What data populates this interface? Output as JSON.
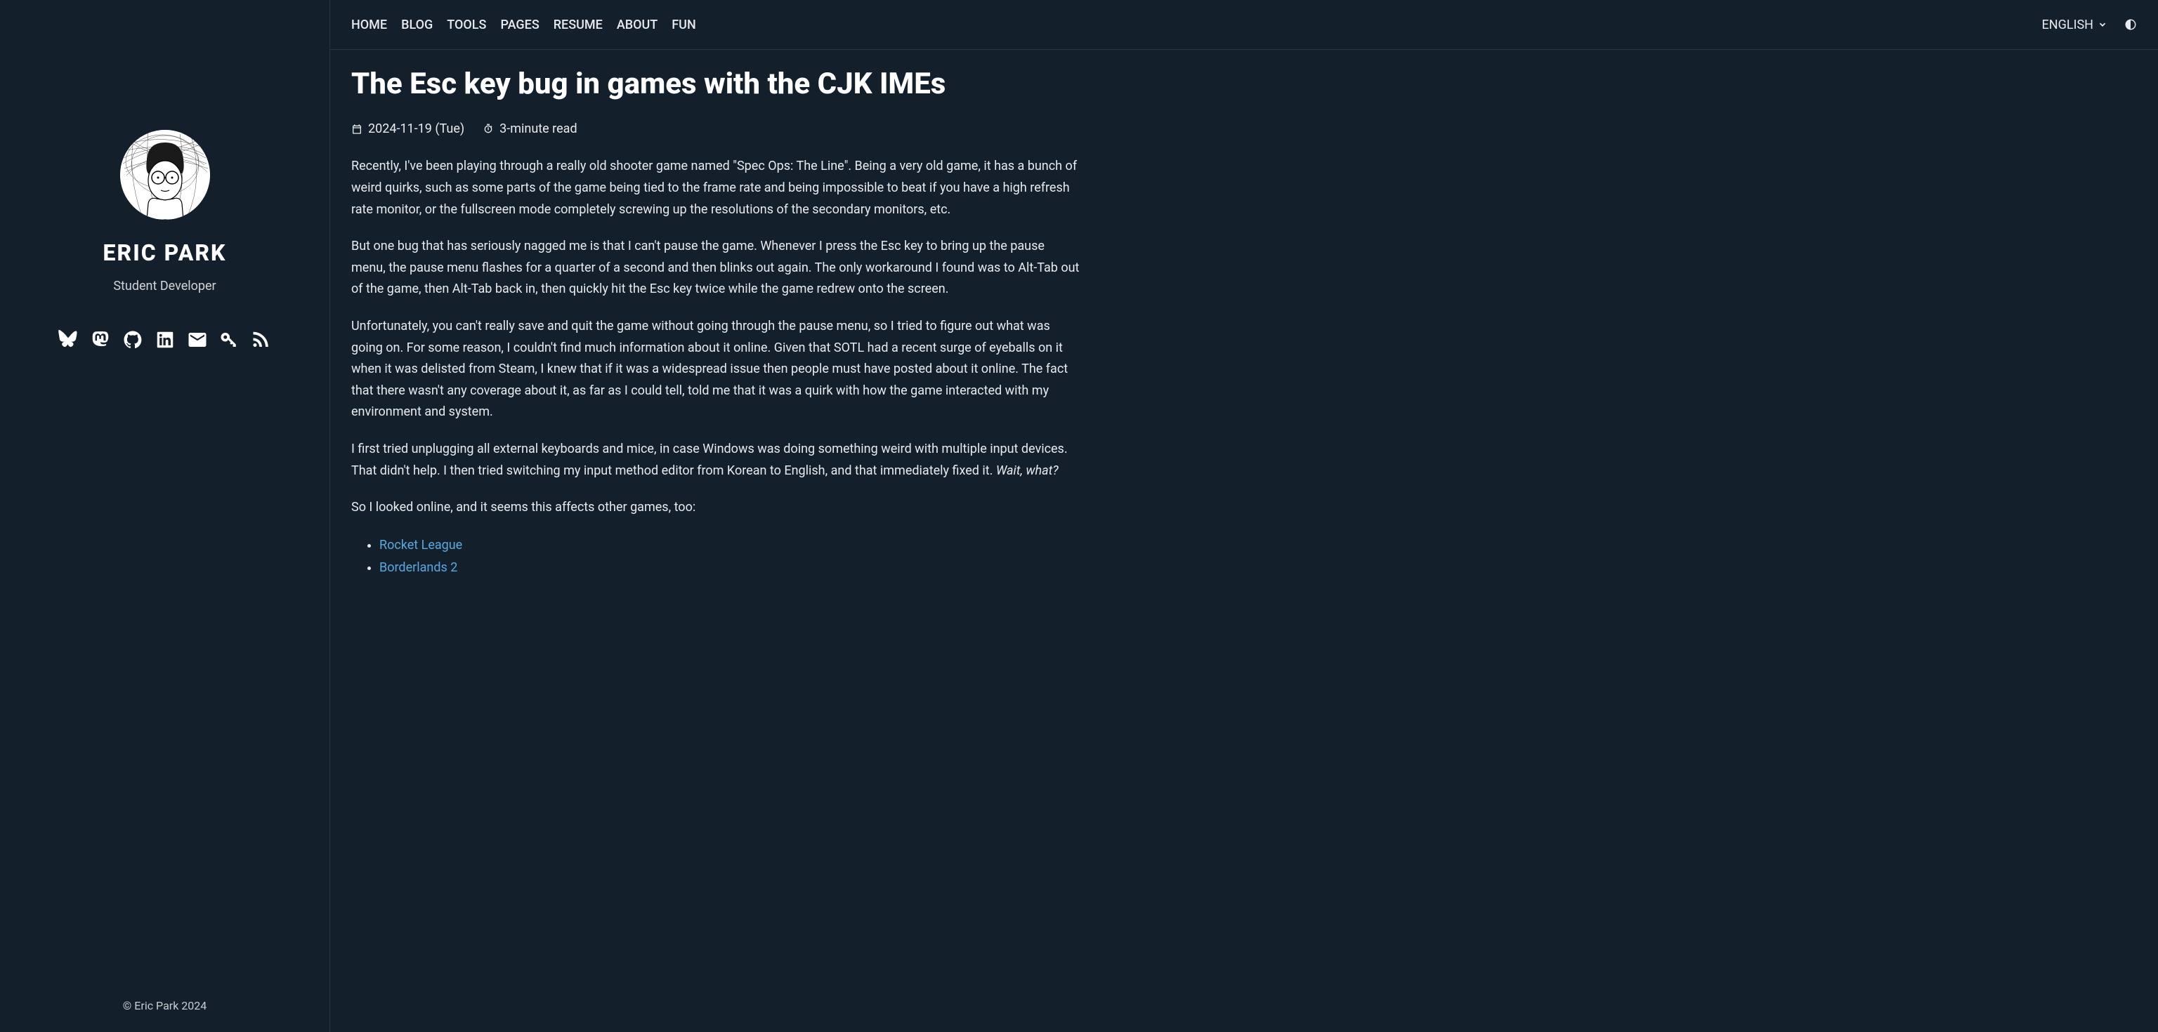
{
  "sidebar": {
    "name": "ERIC PARK",
    "tagline": "Student Developer",
    "copyright": "© Eric Park 2024",
    "socials": [
      {
        "name": "bluesky"
      },
      {
        "name": "mastodon"
      },
      {
        "name": "github"
      },
      {
        "name": "linkedin"
      },
      {
        "name": "email"
      },
      {
        "name": "key"
      },
      {
        "name": "rss"
      }
    ]
  },
  "nav": {
    "items": [
      "HOME",
      "BLOG",
      "TOOLS",
      "PAGES",
      "RESUME",
      "ABOUT",
      "FUN"
    ]
  },
  "topbar": {
    "language": "ENGLISH"
  },
  "post": {
    "title": "The Esc key bug in games with the CJK IMEs",
    "date": "2024-11-19 (Tue)",
    "readtime": "3-minute read",
    "p1": "Recently, I've been playing through a really old shooter game named \"Spec Ops: The Line\". Being a very old game, it has a bunch of weird quirks, such as some parts of the game being tied to the frame rate and being impossible to beat if you have a high refresh rate monitor, or the fullscreen mode completely screwing up the resolutions of the secondary monitors, etc.",
    "p2": "But one bug that has seriously nagged me is that I can't pause the game. Whenever I press the Esc key to bring up the pause menu, the pause menu flashes for a quarter of a second and then blinks out again. The only workaround I found was to Alt-Tab out of the game, then Alt-Tab back in, then quickly hit the Esc key twice while the game redrew onto the screen.",
    "p3": "Unfortunately, you can't really save and quit the game without going through the pause menu, so I tried to figure out what was going on. For some reason, I couldn't find much information about it online. Given that SOTL had a recent surge of eyeballs on it when it was delisted from Steam, I knew that if it was a widespread issue then people must have posted about it online. The fact that there wasn't any coverage about it, as far as I could tell, told me that it was a quirk with how the game interacted with my environment and system.",
    "p4a": "I first tried unplugging all external keyboards and mice, in case Windows was doing something weird with multiple input devices. That didn't help. I then tried switching my input method editor from Korean to English, and that immediately fixed it. ",
    "p4b": "Wait, what?",
    "p5": "So I looked online, and it seems this affects other games, too:",
    "links": [
      "Rocket League",
      "Borderlands 2"
    ]
  }
}
